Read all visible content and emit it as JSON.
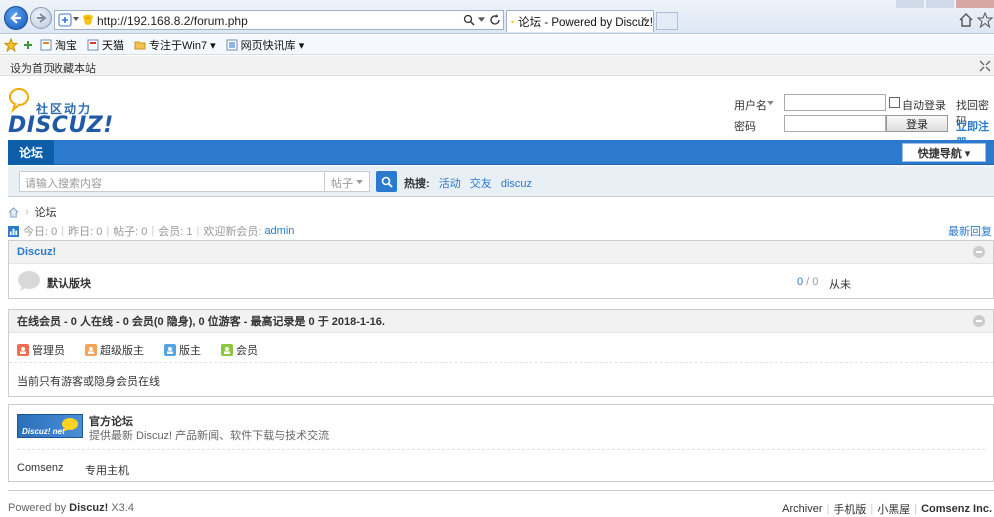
{
  "browser": {
    "url": "http://192.168.8.2/forum.php",
    "tab_title": "论坛 - Powered by Discuz!",
    "tab_close": "×"
  },
  "favorites": [
    "淘宝",
    "天猫",
    "专注于Win7 ▾",
    "网页快讯库 ▾"
  ],
  "commands": {
    "set_home": "设为首页",
    "bookmark": "收藏本站"
  },
  "logo": {
    "brand": "DISCUZ!",
    "tagline": "社区动力"
  },
  "login": {
    "username_label": "用户名",
    "password_label": "密码",
    "auto_login": "自动登录",
    "find_password": "找回密码",
    "login_button": "登录",
    "register": "立即注册"
  },
  "nav": {
    "current": "论坛",
    "quick_nav": "快捷导航 ▾"
  },
  "search": {
    "placeholder": "请输入搜索内容",
    "type": "帖子",
    "hot_label": "热搜:",
    "hot_tags": [
      "活动",
      "交友",
      "discuz"
    ]
  },
  "breadcrumb": {
    "current": "论坛"
  },
  "stats": {
    "today": "今日: 0",
    "yesterday": "昨日: 0",
    "posts": "帖子: 0",
    "members": "会员: 1",
    "welcome": "欢迎新会员:",
    "newest": "admin",
    "latest_reply": "最新回复"
  },
  "category": {
    "title": "Discuz!",
    "forums": [
      {
        "name": "默认版块",
        "count_a": "0",
        "count_b": "0",
        "last": "从未"
      }
    ]
  },
  "online": {
    "title": "在线会员 - 0 人在线 - 0 会员(0 隐身), 0 位游客 - 最高记录是 0 于 2018-1-16.",
    "roles": [
      {
        "name": "管理员",
        "color": "#f26c4f"
      },
      {
        "name": "超级版主",
        "color": "#f7a35c"
      },
      {
        "name": "版主",
        "color": "#52a5e0"
      },
      {
        "name": "会员",
        "color": "#8ec63f"
      }
    ],
    "note": "当前只有游客或隐身会员在线"
  },
  "links": {
    "official_title": "官方论坛",
    "official_desc": "提供最新 Discuz! 产品新闻、软件下载与技术交流",
    "badge": "Discuz! net",
    "text_links": [
      "Comsenz",
      "专用主机"
    ]
  },
  "footer": {
    "powered": "Powered by",
    "brand": "Discuz!",
    "version": "X3.4",
    "links": [
      "Archiver",
      "手机版",
      "小黑屋",
      "Comsenz Inc."
    ]
  }
}
